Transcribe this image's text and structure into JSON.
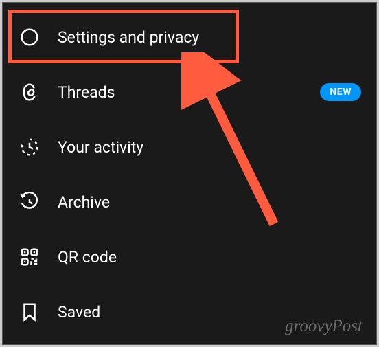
{
  "menu": {
    "items": [
      {
        "label": "Settings and privacy",
        "icon": "gear-icon",
        "badge": null
      },
      {
        "label": "Threads",
        "icon": "threads-icon",
        "badge": "NEW"
      },
      {
        "label": "Your activity",
        "icon": "activity-icon",
        "badge": null
      },
      {
        "label": "Archive",
        "icon": "archive-icon",
        "badge": null
      },
      {
        "label": "QR code",
        "icon": "qr-icon",
        "badge": null
      },
      {
        "label": "Saved",
        "icon": "bookmark-icon",
        "badge": null
      }
    ]
  },
  "badge_text": "NEW",
  "watermark": "groovyPost"
}
